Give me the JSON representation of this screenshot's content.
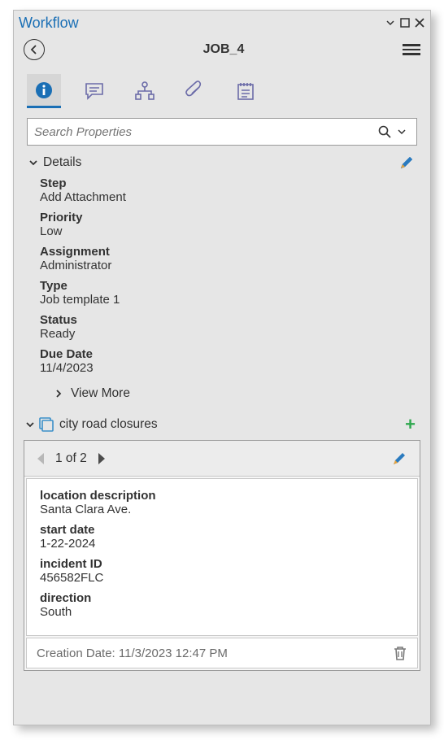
{
  "title": "Workflow",
  "header": {
    "job_title": "JOB_4"
  },
  "search": {
    "placeholder": "Search Properties"
  },
  "details": {
    "section_label": "Details",
    "fields": [
      {
        "label": "Step",
        "value": "Add Attachment"
      },
      {
        "label": "Priority",
        "value": "Low"
      },
      {
        "label": "Assignment",
        "value": "Administrator"
      },
      {
        "label": "Type",
        "value": "Job template 1"
      },
      {
        "label": "Status",
        "value": "Ready"
      },
      {
        "label": "Due Date",
        "value": "11/4/2023"
      }
    ],
    "view_more": "View More"
  },
  "related": {
    "layer_name": "city road closures",
    "pager": "1 of 2",
    "fields": [
      {
        "label": "location description",
        "value": "Santa Clara Ave."
      },
      {
        "label": "start date",
        "value": "1-22-2024"
      },
      {
        "label": "incident ID",
        "value": "456582FLC"
      },
      {
        "label": "direction",
        "value": "South"
      }
    ],
    "creation": "Creation Date: 11/3/2023 12:47 PM"
  }
}
